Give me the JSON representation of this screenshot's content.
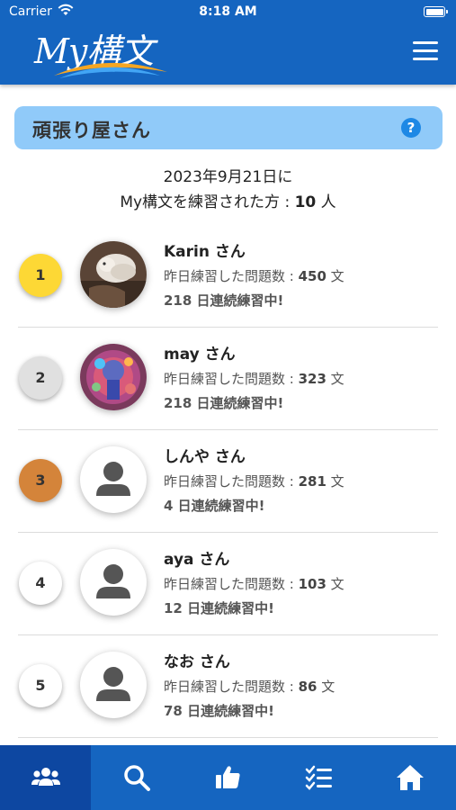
{
  "status_bar": {
    "carrier": "Carrier",
    "time": "8:18 AM",
    "wifi_icon": "wifi-icon",
    "battery_icon": "battery-icon"
  },
  "header": {
    "logo_text": "My構文",
    "menu_icon": "hamburger-menu-icon",
    "color": "#1565c0"
  },
  "banner": {
    "title": "頑張り屋さん",
    "help_label": "?",
    "color": "#90caf9"
  },
  "summary": {
    "date_line": "2023年9月21日に",
    "prefix": "My構文を練習された方 : ",
    "count": "10",
    "unit": " 人"
  },
  "ranking": [
    {
      "rank": "1",
      "badge_color": "#fdd835",
      "name": "Karin さん",
      "problems_label": "昨日練習した問題数 : ",
      "problems": "450",
      "problems_unit": " 文",
      "streak": "218 日連続練習中!",
      "avatar": "photo-cat"
    },
    {
      "rank": "2",
      "badge_color": "#e0e0e0",
      "name": "may さん",
      "problems_label": "昨日練習した問題数 : ",
      "problems": "323",
      "problems_unit": " 文",
      "streak": "218 日連続練習中!",
      "avatar": "photo-colorful"
    },
    {
      "rank": "3",
      "badge_color": "#d4843a",
      "name": "しんや さん",
      "problems_label": "昨日練習した問題数 : ",
      "problems": "281",
      "problems_unit": " 文",
      "streak": "4 日連続練習中!",
      "avatar": "default-person"
    },
    {
      "rank": "4",
      "badge_color": "#ffffff",
      "name": "aya さん",
      "problems_label": "昨日練習した問題数 : ",
      "problems": "103",
      "problems_unit": " 文",
      "streak": "12 日連続練習中!",
      "avatar": "default-person"
    },
    {
      "rank": "5",
      "badge_color": "#ffffff",
      "name": "なお さん",
      "problems_label": "昨日練習した問題数 : ",
      "problems": "86",
      "problems_unit": " 文",
      "streak": "78 日連続練習中!",
      "avatar": "default-person"
    }
  ],
  "tabbar": {
    "tabs": [
      {
        "icon": "users-icon",
        "active": true
      },
      {
        "icon": "search-icon",
        "active": false
      },
      {
        "icon": "thumbs-up-icon",
        "active": false
      },
      {
        "icon": "checklist-icon",
        "active": false
      },
      {
        "icon": "home-icon",
        "active": false
      }
    ],
    "active_color": "#0d47a1"
  }
}
